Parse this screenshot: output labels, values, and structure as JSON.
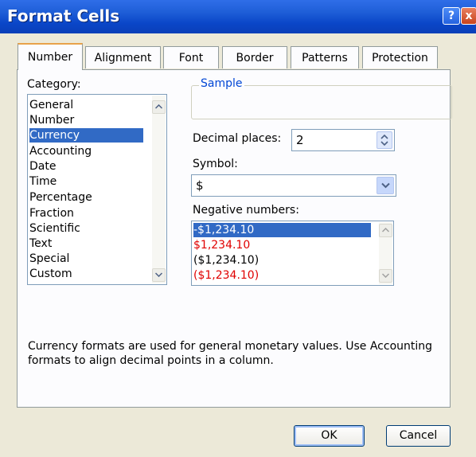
{
  "window": {
    "title": "Format Cells",
    "help_label": "?",
    "close_label": "x"
  },
  "tabs": [
    {
      "label": "Number",
      "active": true
    },
    {
      "label": "Alignment"
    },
    {
      "label": "Font"
    },
    {
      "label": "Border"
    },
    {
      "label": "Patterns"
    },
    {
      "label": "Protection"
    }
  ],
  "category": {
    "label": "Category:",
    "items": [
      "General",
      "Number",
      "Currency",
      "Accounting",
      "Date",
      "Time",
      "Percentage",
      "Fraction",
      "Scientific",
      "Text",
      "Special",
      "Custom"
    ],
    "selected": "Currency"
  },
  "sample": {
    "label": "Sample",
    "value": ""
  },
  "decimal_places": {
    "label": "Decimal places:",
    "value": "2"
  },
  "symbol": {
    "label": "Symbol:",
    "value": "$"
  },
  "negative_numbers": {
    "label": "Negative numbers:",
    "items": [
      {
        "text": "-$1,234.10",
        "color": "black",
        "selected": true
      },
      {
        "text": "$1,234.10",
        "color": "red"
      },
      {
        "text": "($1,234.10)",
        "color": "black"
      },
      {
        "text": "($1,234.10)",
        "color": "red"
      }
    ]
  },
  "description": "Currency formats are used for general monetary values.  Use Accounting formats to align decimal points in a column.",
  "buttons": {
    "ok": "OK",
    "cancel": "Cancel"
  },
  "colors": {
    "titlebar": "#0a46c8",
    "selection": "#316ac5",
    "negative_red": "#e00000",
    "dialog_bg": "#ece9d8",
    "tab_accent": "#e8a24a"
  }
}
